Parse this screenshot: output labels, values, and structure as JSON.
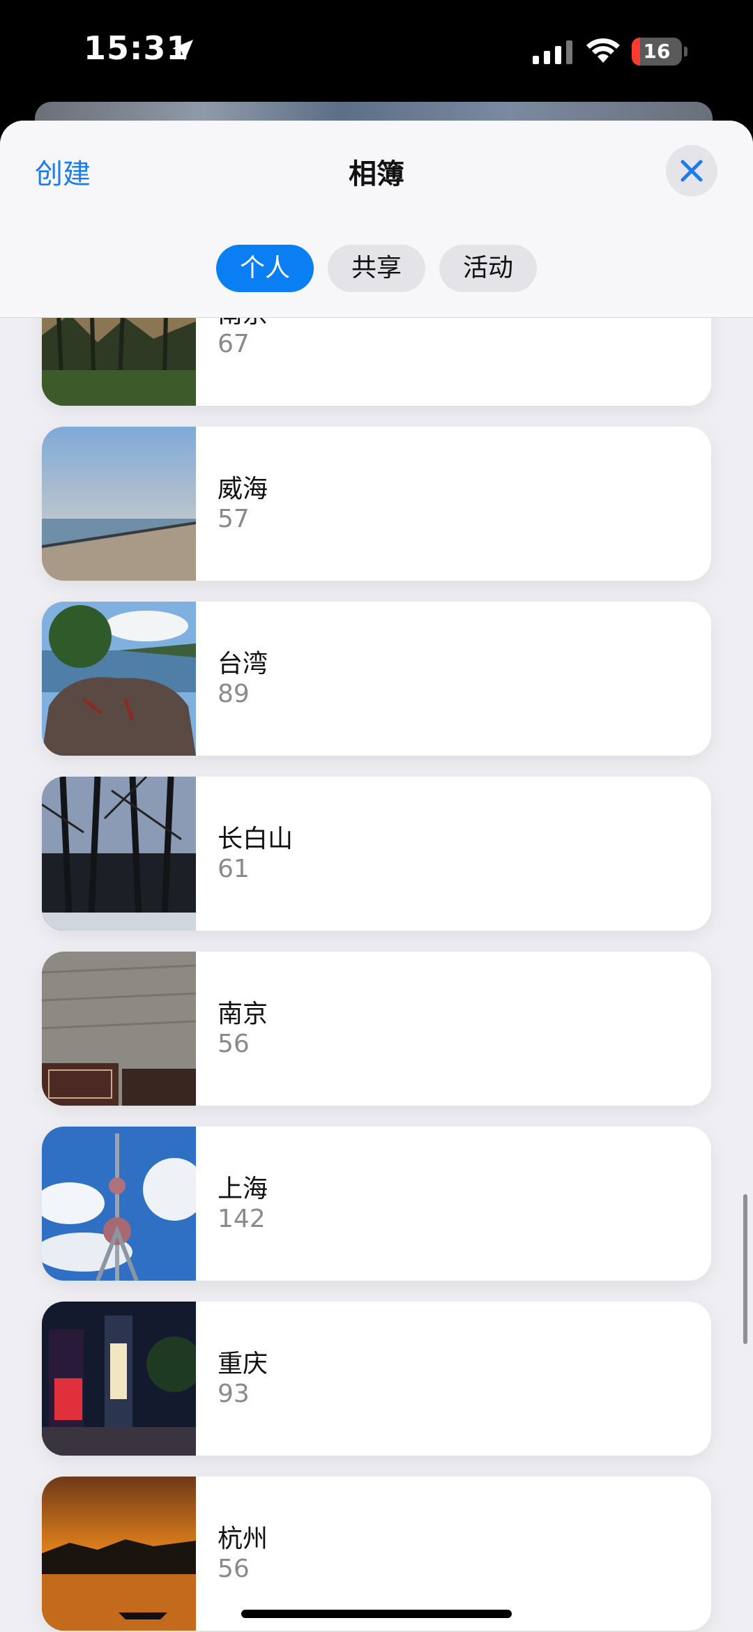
{
  "status_bar": {
    "time": "15:31",
    "battery": "16",
    "battery_level_percent": 16,
    "battery_color": "#ff3b30",
    "icons": [
      "location-arrow-icon",
      "cellular-signal-icon",
      "wifi-icon",
      "battery-icon"
    ]
  },
  "header": {
    "create_label": "创建",
    "title": "相簿",
    "close_icon": "close-icon",
    "accent_color": "#1a7cf0",
    "segments": [
      {
        "label": "个人",
        "selected": true
      },
      {
        "label": "共享",
        "selected": false
      },
      {
        "label": "活动",
        "selected": false
      }
    ]
  },
  "albums": [
    {
      "name": "南京",
      "count": "67",
      "thumb": "forest-dusk"
    },
    {
      "name": "威海",
      "count": "57",
      "thumb": "seaside-promenade"
    },
    {
      "name": "台湾",
      "count": "89",
      "thumb": "lake-rock-pine"
    },
    {
      "name": "长白山",
      "count": "61",
      "thumb": "winter-forest"
    },
    {
      "name": "南京",
      "count": "56",
      "thumb": "city-wall-sign"
    },
    {
      "name": "上海",
      "count": "142",
      "thumb": "tv-tower-sky"
    },
    {
      "name": "重庆",
      "count": "93",
      "thumb": "night-street"
    },
    {
      "name": "杭州",
      "count": "56",
      "thumb": "lake-sunset"
    }
  ]
}
